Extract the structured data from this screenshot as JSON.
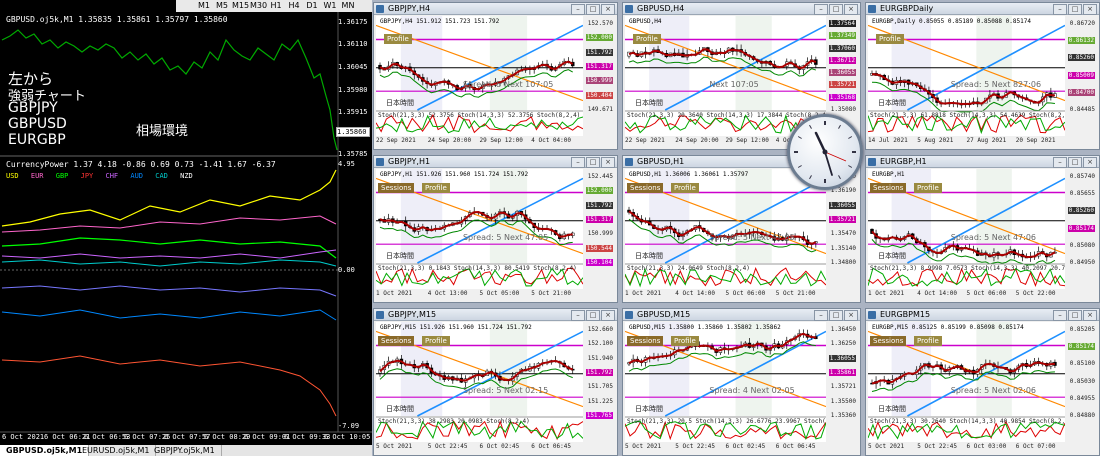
{
  "left": {
    "title": "GBPUSD.oj5k,M1  1.35835 1.35861 1.35797 1.35860",
    "indicator_title": "CurrencyPower 1.37 4.18 -0.86 0.69 0.73 -1.41 1.67 -6.37",
    "currencies": [
      {
        "name": "USD",
        "color": "#ffff00"
      },
      {
        "name": "EUR",
        "color": "#ff66cc"
      },
      {
        "name": "GBP",
        "color": "#00ff00"
      },
      {
        "name": "JPY",
        "color": "#ff3333"
      },
      {
        "name": "CHF",
        "color": "#cc66ff"
      },
      {
        "name": "AUD",
        "color": "#0088ff"
      },
      {
        "name": "CAD",
        "color": "#00cccc"
      },
      {
        "name": "NZD",
        "color": "#ffffff"
      }
    ],
    "overlay_lines": [
      "左から",
      "強弱チャート",
      "GBPJPY",
      "GBPUSD",
      "EURGBP"
    ],
    "overlay_center": "相場環境",
    "price_labels": [
      "1.36175",
      "1.36110",
      "1.36045",
      "1.35980",
      "1.35915",
      "1.35860",
      "1.35785"
    ],
    "ind_labels": [
      "4.95",
      "0.00",
      "-7.09"
    ],
    "time_labels": [
      "6 Oct 2021",
      "6 Oct 06:21",
      "6 Oct 06:53",
      "6 Oct 07:25",
      "6 Oct 07:57",
      "6 Oct 08:29",
      "6 Oct 09:01",
      "6 Oct 09:33",
      "6 Oct 10:05"
    ],
    "tabs": [
      "GBPUSD.oj5k,M1",
      "EURUSD.oj5k,M1",
      "GBPJPY.oj5k,M1"
    ],
    "timeframes": [
      "M1",
      "M5",
      "M15",
      "M30",
      "H1",
      "H4",
      "D1",
      "W1",
      "MN"
    ]
  },
  "windows": [
    {
      "title": "GBPJPY,H4",
      "symline": "GBPJPY,H4  151.912 151.723 151.792",
      "axis": [
        "152.570",
        "152.000",
        "151.792",
        "151.317",
        "150.999",
        "150.404",
        "149.671"
      ],
      "tags": [
        1,
        2,
        3,
        4,
        5
      ],
      "sessions": false,
      "spread": "Spread: 5 Next 107:05",
      "xlabels": [
        "22 Sep 2021",
        "24 Sep 20:00",
        "29 Sep 12:00",
        "4 Oct 04:00"
      ],
      "stoch": "Stoch(21,3,3) 52.3756  Stoch(14,3,3) 52.3756  Stoch(8,2,4)"
    },
    {
      "title": "GBPUSD,H4",
      "symline": "GBPUSD,H4",
      "axis": [
        "1.37564",
        "1.37349",
        "1.37060",
        "1.36712",
        "1.36055",
        "1.35721",
        "1.35168",
        "1.35080"
      ],
      "tags": [
        0,
        1,
        2,
        3,
        4,
        5,
        6
      ],
      "sessions": false,
      "spread": "Next 107:05",
      "xlabels": [
        "22 Sep 2021",
        "24 Sep 20:00",
        "29 Sep 12:00",
        "4 Oct 04:00"
      ],
      "stoch": "Stoch(21,3,3) 20.3640 Stoch(14,3,3) 17.3844 Stoch(8,2,4)"
    },
    {
      "title": "EURGBPDaily",
      "symline": "EURGBP,Daily  0.85055 0.85189 0.85088 0.85174",
      "axis": [
        "0.86720",
        "0.86132",
        "0.85260",
        "0.85009",
        "0.84700",
        "0.84485"
      ],
      "tags": [
        1,
        2,
        3,
        4
      ],
      "sessions": false,
      "spread": "Spread: 5  Next 827:06",
      "xlabels": [
        "14 Jul 2021",
        "5 Aug 2021",
        "27 Aug 2021",
        "20 Sep 2021"
      ],
      "stoch": "Stoch(21,3,3) 61.8818 Stoch(14,3,3) 54.4639 Stoch(8,2,4)"
    },
    {
      "title": "GBPJPY,H1",
      "symline": "GBPJPY,H1  151.926 151.960 151.724 151.792",
      "axis": [
        "152.445",
        "152.000",
        "151.792",
        "151.317",
        "150.999",
        "150.544",
        "150.104"
      ],
      "tags": [
        1,
        2,
        3,
        5,
        6
      ],
      "sessions": true,
      "spread": "Spread: 5 Next 47:05",
      "xlabels": [
        "1 Oct 2021",
        "4 Oct 13:00",
        "5 Oct 05:00",
        "5 Oct 21:00"
      ],
      "stoch": "Stoch(21,3,3) 0.1843 Stoch(14,3,3) 80.5419 Stoch(8,2,4)"
    },
    {
      "title": "GBPUSD,H1",
      "symline": "GBPUSD,H1  1.36006 1.36061 1.35797",
      "axis": [
        "1.36510",
        "1.36190",
        "1.36055",
        "1.35721",
        "1.35470",
        "1.35140",
        "1.34800"
      ],
      "tags": [
        2,
        3
      ],
      "sessions": true,
      "spread": "Spread: 5  Next 47:05",
      "xlabels": [
        "1 Oct 2021",
        "4 Oct 14:00",
        "5 Oct 06:00",
        "5 Oct 21:00"
      ],
      "stoch": "Stoch(21,3,3) 24.0649 Stoch(8,2,4)"
    },
    {
      "title": "EURGBP,H1",
      "symline": "EURGBP,H1",
      "axis": [
        "0.85740",
        "0.85655",
        "0.85260",
        "0.85174",
        "0.85080",
        "0.84950"
      ],
      "tags": [
        2,
        3
      ],
      "sessions": true,
      "spread": "Spread: 5 Next 47:06",
      "xlabels": [
        "1 Oct 2021",
        "4 Oct 14:00",
        "5 Oct 06:00",
        "5 Oct 22:00"
      ],
      "stoch": "Stoch(21,3,3) 8.9998 7.0573 Stoch(14,3,3) 40.2097 20.7181 Stoch(8,2,4)"
    },
    {
      "title": "GBPJPY,M15",
      "symline": "GBPJPY,M15  151.926 151.960 151.724 151.792",
      "axis": [
        "152.660",
        "152.100",
        "151.940",
        "151.792",
        "151.705",
        "151.225",
        "151.765"
      ],
      "tags": [
        3,
        6
      ],
      "sessions": true,
      "spread": "Spread: 5 Next 02:15",
      "xlabels": [
        "5 Oct 2021",
        "5 Oct 22:45",
        "6 Oct 02:45",
        "6 Oct 06:45"
      ],
      "stoch": "Stoch(21,3,3) 38.2983 20.0983 Stoch(8,2,4)"
    },
    {
      "title": "GBPUSD,M15",
      "symline": "GBPUSD,M15  1.35800 1.35860 1.35802 1.35862",
      "axis": [
        "1.36450",
        "1.36250",
        "1.36055",
        "1.35861",
        "1.35721",
        "1.35500",
        "1.35360"
      ],
      "tags": [
        2,
        3
      ],
      "sessions": true,
      "spread": "Spread: 4 Next 02:05",
      "xlabels": [
        "5 Oct 2021",
        "5 Oct 22:45",
        "6 Oct 02:45",
        "6 Oct 06:45"
      ],
      "stoch": "Stoch(21,3,3) 20.5 Stoch(14,3,3) 26.6776 23.9967 Stoch(8,2,4)"
    },
    {
      "title": "EURGBPM15",
      "symline": "EURGBP,M15  0.85125 0.85199 0.85098 0.85174",
      "axis": [
        "0.85205",
        "0.85174",
        "0.85100",
        "0.85030",
        "0.84955",
        "0.84880"
      ],
      "tags": [
        1
      ],
      "sessions": true,
      "spread": "Spread: 5 Next 02:06",
      "xlabels": [
        "5 Oct 2021",
        "5 Oct 22:45",
        "6 Oct 03:00",
        "6 Oct 07:00"
      ],
      "stoch": "Stoch(21,3,3) 30.2640 Stoch(14,3,3) 40.9854 Stoch(8,2,4)"
    }
  ],
  "badge_labels": {
    "sessions": "Sessions",
    "profile": "Profile"
  },
  "jp_label": "日本時間",
  "clock_time": "10:05"
}
